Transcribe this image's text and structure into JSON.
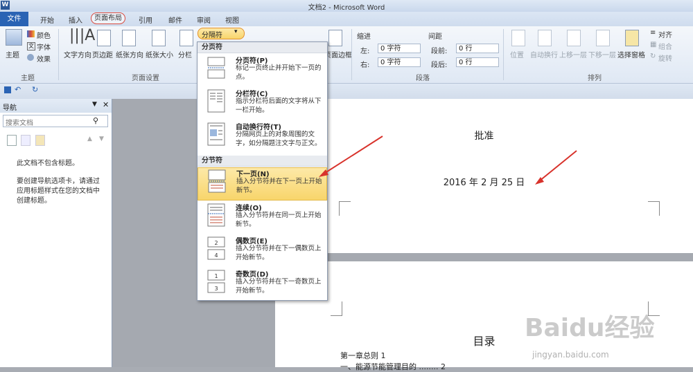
{
  "window": {
    "app_icon": "W",
    "title": "文档2 - Microsoft Word"
  },
  "tabs": [
    {
      "label": "文件"
    },
    {
      "label": "开始"
    },
    {
      "label": "插入"
    },
    {
      "label": "页面布局"
    },
    {
      "label": "引用"
    },
    {
      "label": "邮件"
    },
    {
      "label": "审阅"
    },
    {
      "label": "视图"
    }
  ],
  "ribbon": {
    "theme_group": {
      "theme": "主题",
      "colors": "颜色",
      "fonts": "字体",
      "effects": "效果",
      "label": "主题"
    },
    "page_setup": {
      "text_direction": "文字方向",
      "margins": "页边距",
      "orientation": "纸张方向",
      "size": "纸张大小",
      "columns": "分栏",
      "breaks": "分隔符",
      "label": "页面设置"
    },
    "page_background": {
      "borders": "页面边框"
    },
    "paragraph": {
      "indent": "缩进",
      "spacing": "间距",
      "left": "左:",
      "right": "右:",
      "left_value": "0 字符",
      "right_value": "0 字符",
      "before": "段前:",
      "after": "段后:",
      "before_value": "0 行",
      "after_value": "0 行",
      "label": "段落"
    },
    "arrange": {
      "position": "位置",
      "wrap": "自动换行",
      "bring_forward": "上移一层",
      "send_backward": "下移一层",
      "selection_pane": "选择窗格",
      "align": "对齐",
      "group": "组合",
      "rotate": "旋转",
      "label": "排列"
    }
  },
  "nav_pane": {
    "title": "导航",
    "search_placeholder": "搜索文档",
    "no_headings": "此文档不包含标题。",
    "hint": "要创建导航选项卡，请通过应用标题样式在您的文档中创建标题。"
  },
  "dropdown": {
    "section1": "分页符",
    "section2": "分节符",
    "items": [
      {
        "title": "分页符(P)",
        "desc": "标记一页终止并开始下一页的点。"
      },
      {
        "title": "分栏符(C)",
        "desc": "指示分栏符后面的文字将从下一栏开始。"
      },
      {
        "title": "自动换行符(T)",
        "desc": "分隔网页上的对象周围的文字，如分隔题注文字与正文。"
      },
      {
        "title": "下一页(N)",
        "desc": "插入分节符并在下一页上开始新节。"
      },
      {
        "title": "连续(O)",
        "desc": "插入分节符并在同一页上开始新节。"
      },
      {
        "title": "偶数页(E)",
        "desc": "插入分节符并在下一偶数页上开始新节。"
      },
      {
        "title": "奇数页(D)",
        "desc": "插入分节符并在下一奇数页上开始新节。"
      }
    ]
  },
  "document": {
    "page1_title": "批准",
    "page1_date": "2016 年 2 月 25 日",
    "page2_title": "目录",
    "toc_line1": "第一章总则   1",
    "toc_line2": "一、能源节能管理目的 ........ 2"
  },
  "watermark": {
    "brand": "Baidu经验",
    "url": "jingyan.baidu.com"
  },
  "colors": {
    "accent": "#2a63b4",
    "highlight": "#f8d56b",
    "annotation": "#d8322b"
  }
}
